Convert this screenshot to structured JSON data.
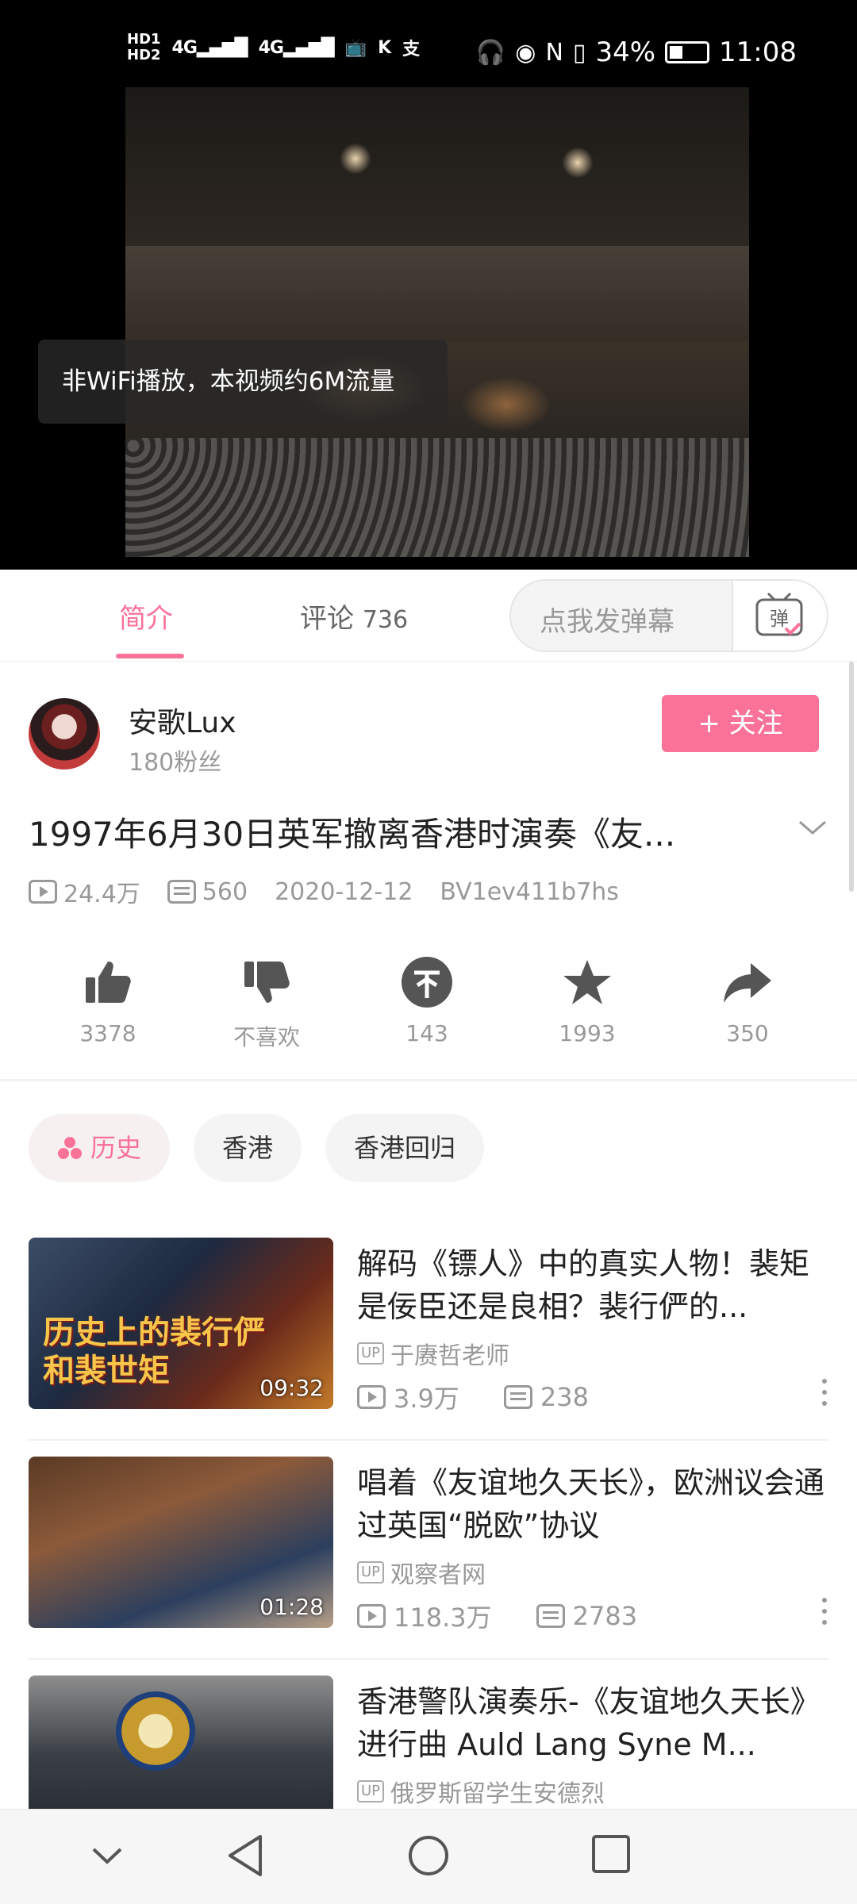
{
  "status_bar": {
    "left_indicators": [
      "HD1",
      "HD2",
      "4G",
      "4G"
    ],
    "battery": "34%",
    "time": "11:08"
  },
  "video": {
    "toast": "非WiFi播放，本视频约6M流量"
  },
  "tabs": {
    "intro": "简介",
    "comments_label": "评论",
    "comments_count": "736",
    "danmaku_placeholder": "点我发弹幕",
    "danmaku_button": "弹"
  },
  "uploader": {
    "name": "安歌Lux",
    "fans": "180粉丝",
    "follow_label": "+ 关注"
  },
  "video_info": {
    "title": "1997年6月30日英军撤离香港时演奏《友...",
    "views": "24.4万",
    "danmaku": "560",
    "date": "2020-12-12",
    "bvid": "BV1ev411b7hs"
  },
  "actions": [
    {
      "icon": "thumb-up-icon",
      "label": "3378"
    },
    {
      "icon": "thumb-down-icon",
      "label": "不喜欢"
    },
    {
      "icon": "coin-icon",
      "label": "143"
    },
    {
      "icon": "star-icon",
      "label": "1993"
    },
    {
      "icon": "share-icon",
      "label": "350"
    }
  ],
  "tags": [
    "历史",
    "香港",
    "香港回归"
  ],
  "related": [
    {
      "title": "解码《镖人》中的真实人物！裴矩是佞臣还是良相？裴行俨的...",
      "thumb_text": "历史上的裴行俨和裴世矩",
      "duration": "09:32",
      "up": "于赓哲老师",
      "views": "3.9万",
      "comments": "238"
    },
    {
      "title": "唱着《友谊地久天长》，欧洲议会通过英国“脱欧”协议",
      "duration": "01:28",
      "up": "观察者网",
      "views": "118.3万",
      "comments": "2783"
    },
    {
      "title": "香港警队演奏乐-《友谊地久天长》进行曲 Auld Lang Syne M...",
      "up": "俄罗斯留学生安德烈"
    }
  ],
  "colors": {
    "accent": "#fb7299",
    "muted": "#999999"
  }
}
